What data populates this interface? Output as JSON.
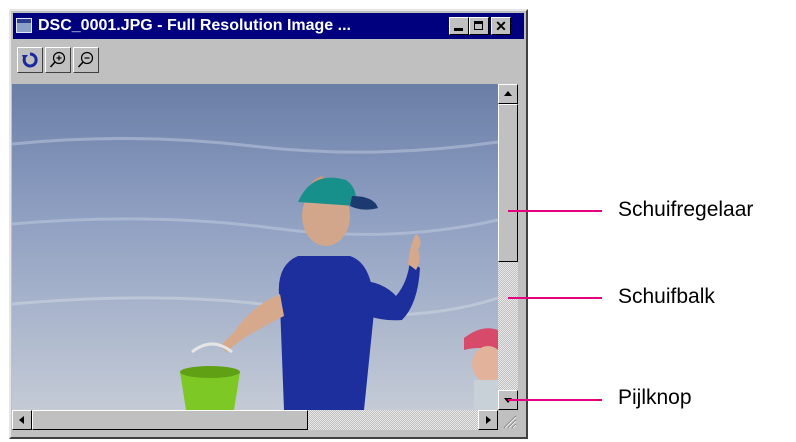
{
  "window": {
    "title": "DSC_0001.JPG - Full Resolution Image ...",
    "controls": [
      "minimize",
      "maximize",
      "close"
    ],
    "close_glyph": "✕",
    "title_bar_color": "#00007f"
  },
  "toolbar": {
    "tools": [
      {
        "icon": "rotate-icon"
      },
      {
        "icon": "zoom-in-icon"
      },
      {
        "icon": "zoom-out-icon"
      }
    ]
  },
  "image": {
    "description": "photo of child at beach"
  },
  "callouts": [
    {
      "label": "Schuifregelaar"
    },
    {
      "label": "Schuifbalk"
    },
    {
      "label": "Pijlknop"
    }
  ],
  "colors": {
    "callout_line": "#e6007e",
    "window_face": "#c0c0c0"
  }
}
